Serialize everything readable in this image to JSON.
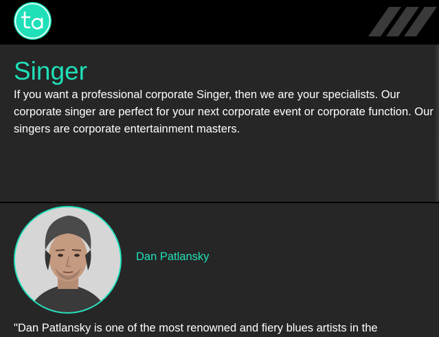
{
  "header": {
    "logo_text": "ta",
    "logo_icon": "ta-logo-icon",
    "decoration": "diagonal-stripes"
  },
  "hero": {
    "title": "Singer",
    "intro": "If you want a professional corporate Singer, then we are your specialists. Our corporate singer are perfect for your next corporate event or corporate function. Our singers are corporate entertainment masters."
  },
  "profile": {
    "name": "Dan Patlansky",
    "quote": "\"Dan Patlansky is one of the most renowned and fiery blues artists in the"
  },
  "colors": {
    "accent": "#1fe0b8",
    "background": "#262626",
    "header": "#000000",
    "text": "#ffffff"
  }
}
